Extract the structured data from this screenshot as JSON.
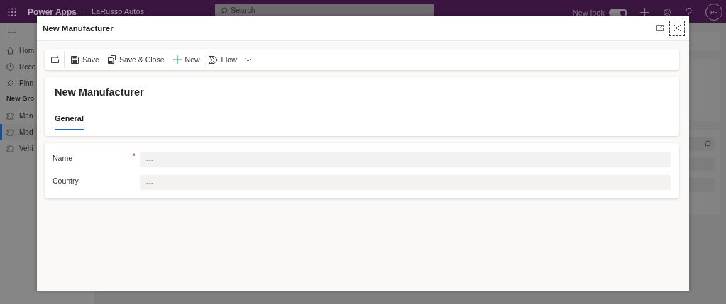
{
  "app": {
    "title": "Power Apps",
    "environment": "LaRusso Autos",
    "search": {
      "placeholder": "Search"
    },
    "new_look": {
      "label": "New look",
      "on": true
    },
    "avatar": "PF"
  },
  "sidebar": {
    "nav": [
      {
        "label": "Hom",
        "selected": false
      },
      {
        "label": "Rece",
        "selected": false
      },
      {
        "label": "Pinn",
        "selected": false
      }
    ],
    "group": {
      "title": "New Gro",
      "items": [
        {
          "label": "Man",
          "selected": false
        },
        {
          "label": "Mod",
          "selected": true
        },
        {
          "label": "Vehi",
          "selected": false
        }
      ]
    }
  },
  "dialog": {
    "title": "New Manufacturer",
    "commands": [
      {
        "label": "Save",
        "dropdown": false
      },
      {
        "label": "Save & Close",
        "dropdown": false
      },
      {
        "label": "New",
        "dropdown": false
      },
      {
        "label": "Flow",
        "dropdown": true
      }
    ],
    "form_title": "New Manufacturer",
    "tabs": [
      {
        "label": "General",
        "selected": true
      }
    ],
    "fields": [
      {
        "label": "Name",
        "required_mark": "*",
        "placeholder": "---"
      },
      {
        "label": "Country",
        "placeholder": "---"
      }
    ]
  }
}
